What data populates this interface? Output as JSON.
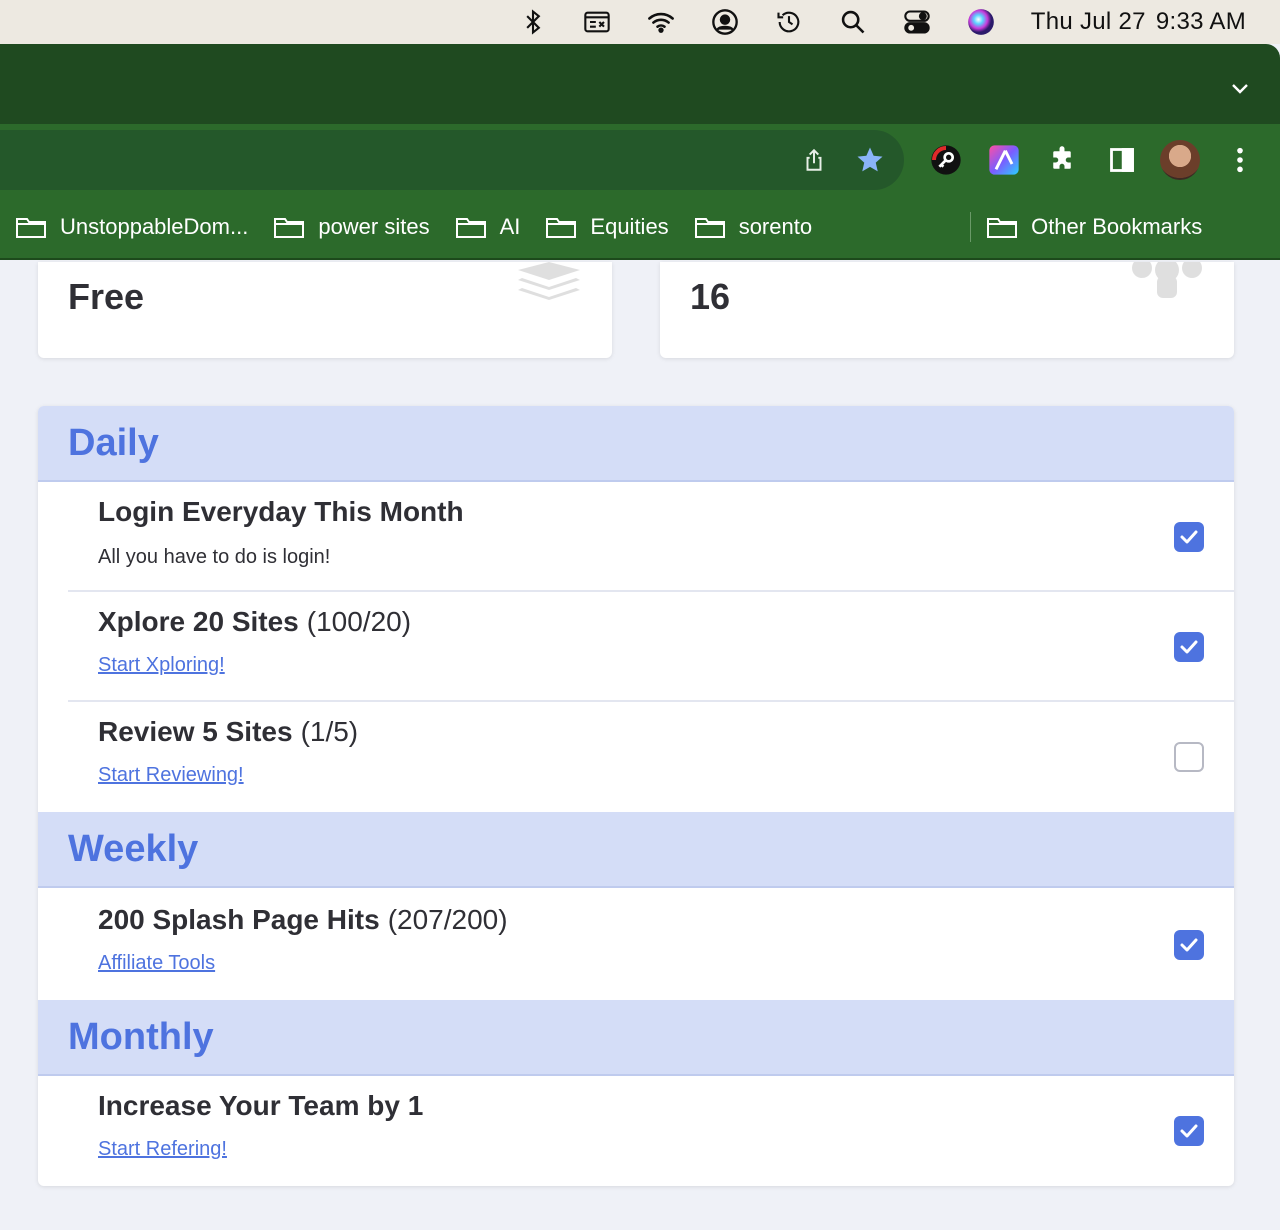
{
  "menubar": {
    "icons": [
      "bluetooth-icon",
      "keyboard-viewer-icon",
      "wifi-icon",
      "user-account-icon",
      "time-machine-icon",
      "spotlight-search-icon",
      "control-center-icon",
      "siri-icon"
    ],
    "date": "Thu Jul 27",
    "time": "9:33 AM"
  },
  "browser": {
    "toolbar_icons": [
      "share-icon",
      "bookmark-star-icon",
      "password-extension-icon",
      "color-app-extension-icon",
      "extensions-puzzle-icon",
      "side-panel-icon",
      "profile-avatar",
      "menu-kebab-icon"
    ],
    "bookmarks": [
      {
        "label": "UnstoppableDom..."
      },
      {
        "label": "power sites"
      },
      {
        "label": "AI"
      },
      {
        "label": "Equities"
      },
      {
        "label": "sorento"
      }
    ],
    "other_bookmarks": "Other Bookmarks"
  },
  "stats": {
    "membership_value": "Free",
    "membership_icon": "layers-icon",
    "count_value": "16",
    "count_icon": "users-group-icon"
  },
  "sections": {
    "daily": {
      "title": "Daily",
      "tasks": [
        {
          "title": "Login Everyday This Month",
          "progress": "",
          "subtitle": "All you have to do is login!",
          "checked": true
        },
        {
          "title": "Xplore 20 Sites",
          "progress": "(100/20)",
          "link": "Start Xploring!",
          "checked": true
        },
        {
          "title": "Review 5 Sites",
          "progress": "(1/5)",
          "link": "Start Reviewing!",
          "checked": false
        }
      ]
    },
    "weekly": {
      "title": "Weekly",
      "tasks": [
        {
          "title": "200 Splash Page Hits",
          "progress": "(207/200)",
          "link": "Affiliate Tools",
          "checked": true
        }
      ]
    },
    "monthly": {
      "title": "Monthly",
      "tasks": [
        {
          "title": "Increase Your Team by 1",
          "progress": "",
          "link": "Start Refering!",
          "checked": true
        }
      ]
    }
  },
  "colors": {
    "accent": "#4e73df",
    "section_bg": "#d4ddf7",
    "browser_green": "#2c6a2b"
  }
}
